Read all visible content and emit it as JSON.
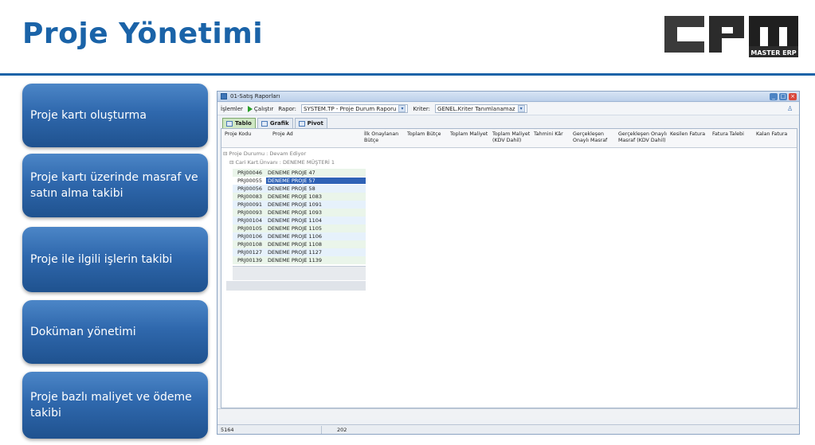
{
  "slide": {
    "title": "Proje Yönetimi",
    "accent_color": "#1a63a8",
    "logo_text": "MASTER ERP"
  },
  "features": [
    "Proje kartı oluşturma",
    "Proje kartı üzerinde masraf ve satın alma takibi",
    "Proje ile ilgili işlerin takibi",
    "Doküman yönetimi",
    "Proje bazlı maliyet ve ödeme takibi"
  ],
  "window": {
    "title": "01-Satış Raporları",
    "toolbar": {
      "menu": "İşlemler",
      "run": "Çalıştır",
      "report_label": "Rapor:",
      "report_value": "SYSTEM.TP - Proje Durum Raporu",
      "criteria_label": "Kriter:",
      "criteria_value": "GENEL.Kriter Tanımlanamaz"
    },
    "tabs": [
      "Tablo",
      "Grafik",
      "Pivot"
    ],
    "columns": [
      "Proje Kodu",
      "Proje Ad",
      "İlk Onaylanan Bütçe",
      "Toplam Bütçe",
      "Toplam Maliyet",
      "Toplam Maliyet (KDV Dahil)",
      "Tahmini Kâr",
      "Gerçekleşen Onaylı Masraf",
      "Gerçekleşen Onaylı Masraf (KDV Dahil)",
      "Kesilen Fatura",
      "Fatura Talebi",
      "Kalan Fatura"
    ],
    "group1": "⊟ Proje Durumu : Devam Ediyor",
    "group2": "⊟ Cari Kart.Ünvanı : DENEME MÜŞTERİ 1",
    "rows": [
      {
        "code": "PRJ00046",
        "name": "DENEME PROJE 47"
      },
      {
        "code": "PRJ00055",
        "name": "DENEME PROJE 57"
      },
      {
        "code": "PRJ00056",
        "name": "DENEME PROJE 58"
      },
      {
        "code": "PRJ00083",
        "name": "DENEME PROJE 1083"
      },
      {
        "code": "PRJ00091",
        "name": "DENEME PROJE 1091"
      },
      {
        "code": "PRJ00093",
        "name": "DENEME PROJE 1093"
      },
      {
        "code": "PRJ00104",
        "name": "DENEME PROJE 1104"
      },
      {
        "code": "PRJ00105",
        "name": "DENEME PROJE 1105"
      },
      {
        "code": "PRJ00106",
        "name": "DENEME PROJE 1106"
      },
      {
        "code": "PRJ00108",
        "name": "DENEME PROJE 1108"
      },
      {
        "code": "PRJ00127",
        "name": "DENEME PROJE 1127"
      },
      {
        "code": "PRJ00139",
        "name": "DENEME PROJE 1139"
      }
    ],
    "status": {
      "left": "5164",
      "right": "202"
    }
  }
}
